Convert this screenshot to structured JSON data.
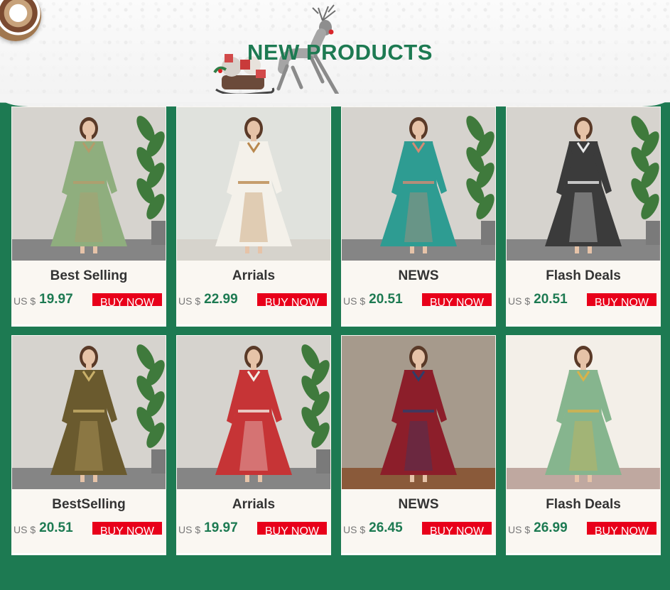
{
  "header": {
    "title": "NEW PRODUCTS"
  },
  "products": [
    {
      "label": "Best Selling",
      "currency": "US $",
      "price": "19.97",
      "button": "BUY NOW",
      "bg": "#d6d3ce",
      "floor": "#858585",
      "dress": "#8fae7e",
      "accent": "#b49b6b",
      "plant": true
    },
    {
      "label": "Arrials",
      "currency": "US $",
      "price": "22.99",
      "button": "BUY NOW",
      "bg": "#e0e2dd",
      "floor": "#d6d3cc",
      "dress": "#f4f1ea",
      "accent": "#b9884e",
      "plant": false
    },
    {
      "label": "NEWS",
      "currency": "US $",
      "price": "20.51",
      "button": "BUY NOW",
      "bg": "#d6d3ce",
      "floor": "#858585",
      "dress": "#2e9c92",
      "accent": "#d58a73",
      "plant": true
    },
    {
      "label": "Flash Deals",
      "currency": "US $",
      "price": "20.51",
      "button": "BUY NOW",
      "bg": "#d6d3ce",
      "floor": "#858585",
      "dress": "#3b3b3b",
      "accent": "#e8e8e8",
      "plant": true
    },
    {
      "label": "BestSelling",
      "currency": "US $",
      "price": "20.51",
      "button": "BUY NOW",
      "bg": "#d6d3ce",
      "floor": "#858585",
      "dress": "#6a5a2e",
      "accent": "#c9b06a",
      "plant": true
    },
    {
      "label": "Arrials",
      "currency": "US $",
      "price": "19.97",
      "button": "BUY NOW",
      "bg": "#d6d3ce",
      "floor": "#858585",
      "dress": "#c63436",
      "accent": "#f1ebe4",
      "plant": true
    },
    {
      "label": "NEWS",
      "currency": "US $",
      "price": "26.45",
      "button": "BUY NOW",
      "bg": "#a69a8c",
      "floor": "#8a5a3a",
      "dress": "#8c1e2a",
      "accent": "#2f3d6a",
      "plant": false
    },
    {
      "label": "Flash Deals",
      "currency": "US $",
      "price": "26.99",
      "button": "BUY NOW",
      "bg": "#f3efe8",
      "floor": "#bfa8a0",
      "dress": "#86b58e",
      "accent": "#d8b24a",
      "plant": false
    }
  ]
}
